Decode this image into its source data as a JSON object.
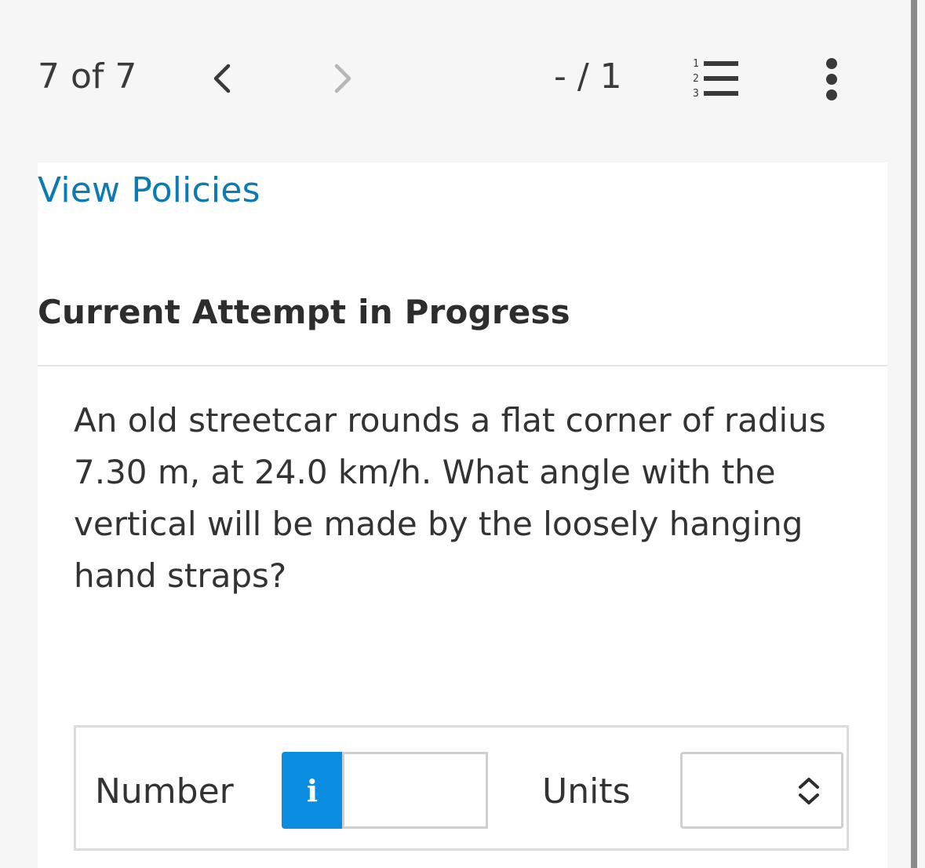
{
  "header": {
    "counter": "7 of 7",
    "score": "- / 1",
    "prev_icon": "chevron-left-icon",
    "next_icon": "chevron-right-icon",
    "list_icon": "numbered-list-icon",
    "more_icon": "more-vertical-icon",
    "list_numbers": [
      "1",
      "2",
      "3"
    ]
  },
  "links": {
    "view_policies": "View Policies"
  },
  "section": {
    "heading": "Current Attempt in Progress"
  },
  "question": {
    "text": "An old streetcar rounds a flat corner of radius 7.30 m, at 24.0 km/h. What angle with the vertical will be made by the loosely hanging hand straps?"
  },
  "answer": {
    "number_label": "Number",
    "info_label": "i",
    "number_value": "",
    "units_label": "Units",
    "units_value": ""
  },
  "colors": {
    "link": "#0a7bb5",
    "info_button": "#0a8de0",
    "background": "#f6f6f6"
  }
}
